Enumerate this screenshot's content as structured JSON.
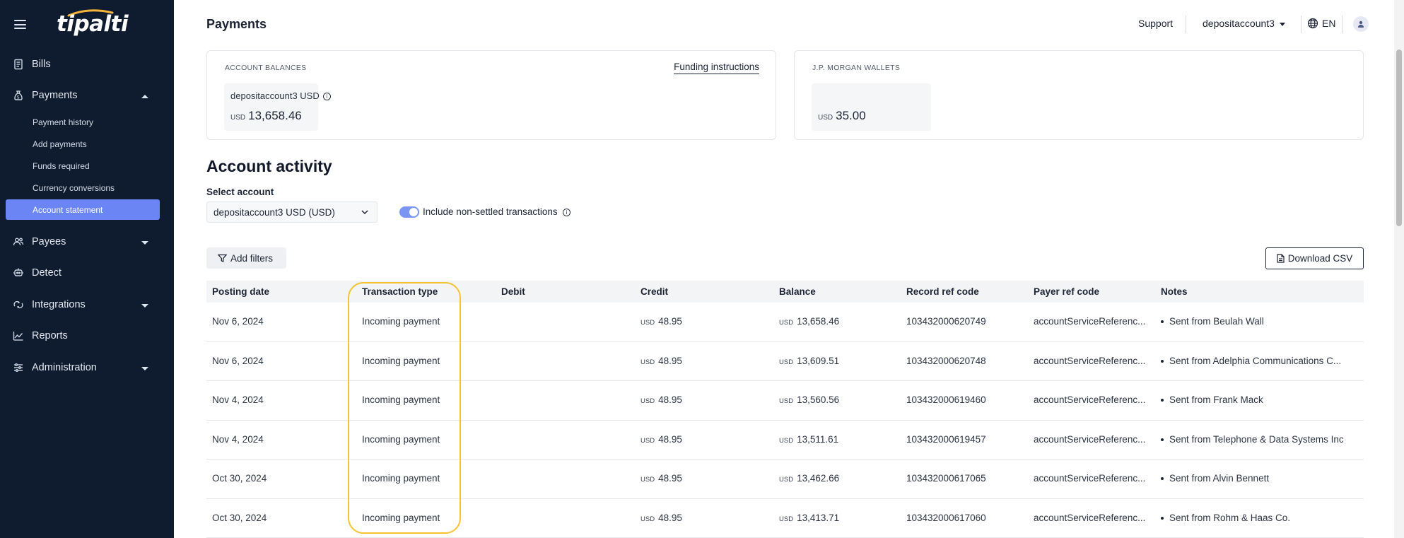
{
  "app": {
    "logo": "tipalti"
  },
  "sidebar": {
    "items": [
      {
        "label": "Bills",
        "icon": "bills-icon"
      },
      {
        "label": "Payments",
        "icon": "money-bag-icon"
      },
      {
        "label": "Payees",
        "icon": "users-icon"
      },
      {
        "label": "Detect",
        "icon": "detect-icon"
      },
      {
        "label": "Integrations",
        "icon": "integrations-icon"
      },
      {
        "label": "Reports",
        "icon": "reports-icon"
      },
      {
        "label": "Administration",
        "icon": "administration-icon"
      }
    ],
    "payments_sub": [
      {
        "label": "Payment history"
      },
      {
        "label": "Add payments"
      },
      {
        "label": "Funds required"
      },
      {
        "label": "Currency conversions"
      },
      {
        "label": "Account statement"
      }
    ],
    "active_color": "#6b86f4"
  },
  "header": {
    "title": "Payments",
    "support": "Support",
    "account": "depositaccount3",
    "language": "EN"
  },
  "balances": {
    "account_title": "ACCOUNT BALANCES",
    "funding_link": "Funding instructions",
    "account_name": "depositaccount3 USD",
    "account_currency": "USD",
    "account_amount": "13,658.46",
    "wallet_title": "J.P. MORGAN WALLETS",
    "wallet_currency": "USD",
    "wallet_amount": "35.00"
  },
  "activity": {
    "title": "Account activity",
    "select_label": "Select account",
    "select_value": "depositaccount3 USD (USD)",
    "toggle_label": "Include non-settled transactions",
    "toggle_on": true,
    "add_filters": "Add filters",
    "download_csv": "Download CSV"
  },
  "table": {
    "headers": [
      "Posting date",
      "Transaction type",
      "Debit",
      "Credit",
      "Balance",
      "Record ref code",
      "Payer ref code",
      "Notes"
    ],
    "rows": [
      {
        "date": "Nov 6, 2024",
        "type": "Incoming payment",
        "debit": "",
        "credit_cur": "USD",
        "credit": "48.95",
        "balance_cur": "USD",
        "balance": "13,658.46",
        "record": "103432000620749",
        "payer": "accountServiceReferenc...",
        "notes": "Sent from Beulah Wall"
      },
      {
        "date": "Nov 6, 2024",
        "type": "Incoming payment",
        "debit": "",
        "credit_cur": "USD",
        "credit": "48.95",
        "balance_cur": "USD",
        "balance": "13,609.51",
        "record": "103432000620748",
        "payer": "accountServiceReferenc...",
        "notes": "Sent from Adelphia Communications C..."
      },
      {
        "date": "Nov 4, 2024",
        "type": "Incoming payment",
        "debit": "",
        "credit_cur": "USD",
        "credit": "48.95",
        "balance_cur": "USD",
        "balance": "13,560.56",
        "record": "103432000619460",
        "payer": "accountServiceReferenc...",
        "notes": "Sent from Frank Mack"
      },
      {
        "date": "Nov 4, 2024",
        "type": "Incoming payment",
        "debit": "",
        "credit_cur": "USD",
        "credit": "48.95",
        "balance_cur": "USD",
        "balance": "13,511.61",
        "record": "103432000619457",
        "payer": "accountServiceReferenc...",
        "notes": "Sent from Telephone & Data Systems Inc"
      },
      {
        "date": "Oct 30, 2024",
        "type": "Incoming payment",
        "debit": "",
        "credit_cur": "USD",
        "credit": "48.95",
        "balance_cur": "USD",
        "balance": "13,462.66",
        "record": "103432000617065",
        "payer": "accountServiceReferenc...",
        "notes": "Sent from Alvin Bennett"
      },
      {
        "date": "Oct 30, 2024",
        "type": "Incoming payment",
        "debit": "",
        "credit_cur": "USD",
        "credit": "48.95",
        "balance_cur": "USD",
        "balance": "13,413.71",
        "record": "103432000617060",
        "payer": "accountServiceReferenc...",
        "notes": "Sent from Rohm & Haas Co."
      }
    ]
  },
  "annotation": {
    "highlight_color": "#f6c234"
  }
}
